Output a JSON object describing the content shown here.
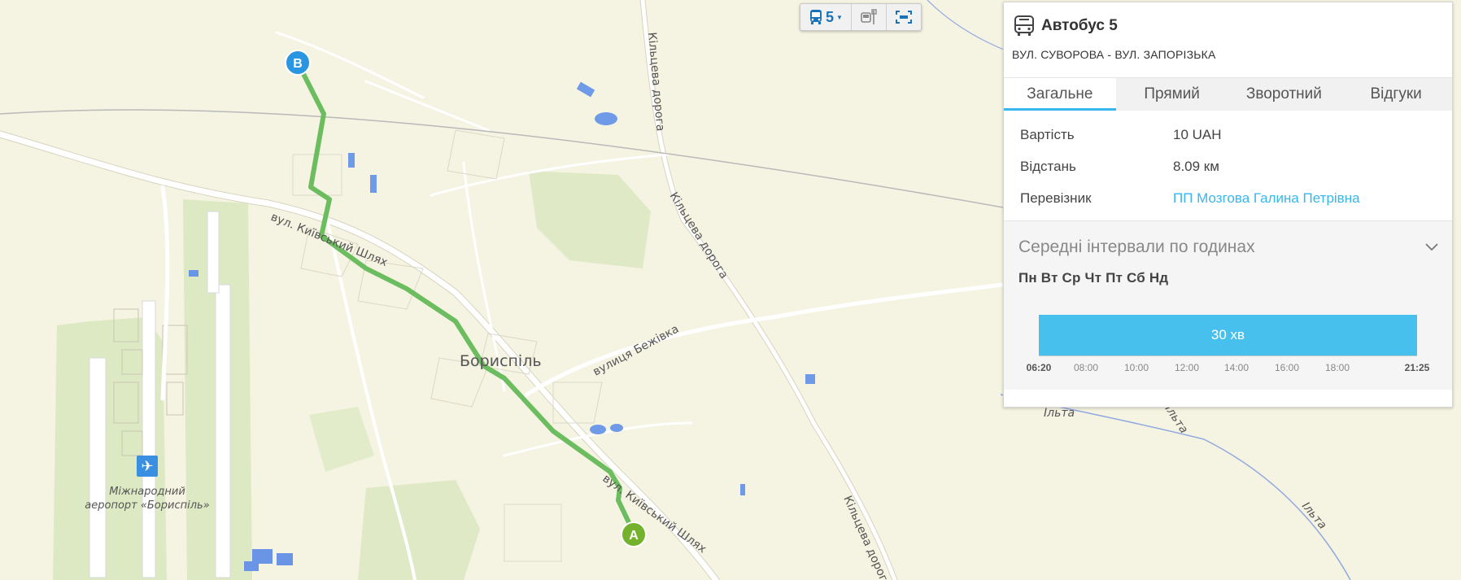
{
  "map": {
    "city_label": "Бориспіль",
    "airport_label_line1": "Міжнародний",
    "airport_label_line2": "аеропорт «Бориспіль»",
    "street_kyivskyi_1": "вул. Київський Шлях",
    "street_kyivskyi_2": "вул. Київський Шлях",
    "street_bezhivka": "вулиця Бежівка",
    "street_kiltseva_1": "Кільцева дорога",
    "street_kiltseva_2": "Кільцева дорога",
    "street_kiltseva_3": "Кільцева дорога",
    "river_1": "Ільта",
    "river_2": "Ільта",
    "river_3": "Ільта",
    "marker_start": "A",
    "marker_end": "B",
    "route_color": "#6cbd5f",
    "marker_start_color": "#74b22d",
    "marker_end_color": "#2a95e0"
  },
  "toolbar": {
    "route_number": "5",
    "route_icon": "bus-icon",
    "stops_icon": "bus-stop-icon",
    "fit_icon": "fit-screen-icon"
  },
  "panel": {
    "title": "Автобус 5",
    "subtitle": "ВУЛ. СУВОРОВА - ВУЛ. ЗАПОРІЗЬКА",
    "tabs": [
      {
        "label": "Загальне",
        "active": true
      },
      {
        "label": "Прямий",
        "active": false
      },
      {
        "label": "Зворотний",
        "active": false
      },
      {
        "label": "Відгуки",
        "active": false
      }
    ],
    "info": [
      {
        "key": "Вартість",
        "value": "10 UAH"
      },
      {
        "key": "Відстань",
        "value": "8.09 км"
      },
      {
        "key": "Перевізник",
        "value": "ПП Мозгова Галина Петрівна"
      }
    ],
    "intervals_title": "Середні інтервали по годинах",
    "days": "Пн Вт Ср Чт Пт Сб Нд",
    "bar_label": "30 хв",
    "ticks": [
      "06:20",
      "08:00",
      "10:00",
      "12:00",
      "14:00",
      "16:00",
      "18:00",
      "21:25"
    ],
    "accent": "#38b6ee"
  }
}
